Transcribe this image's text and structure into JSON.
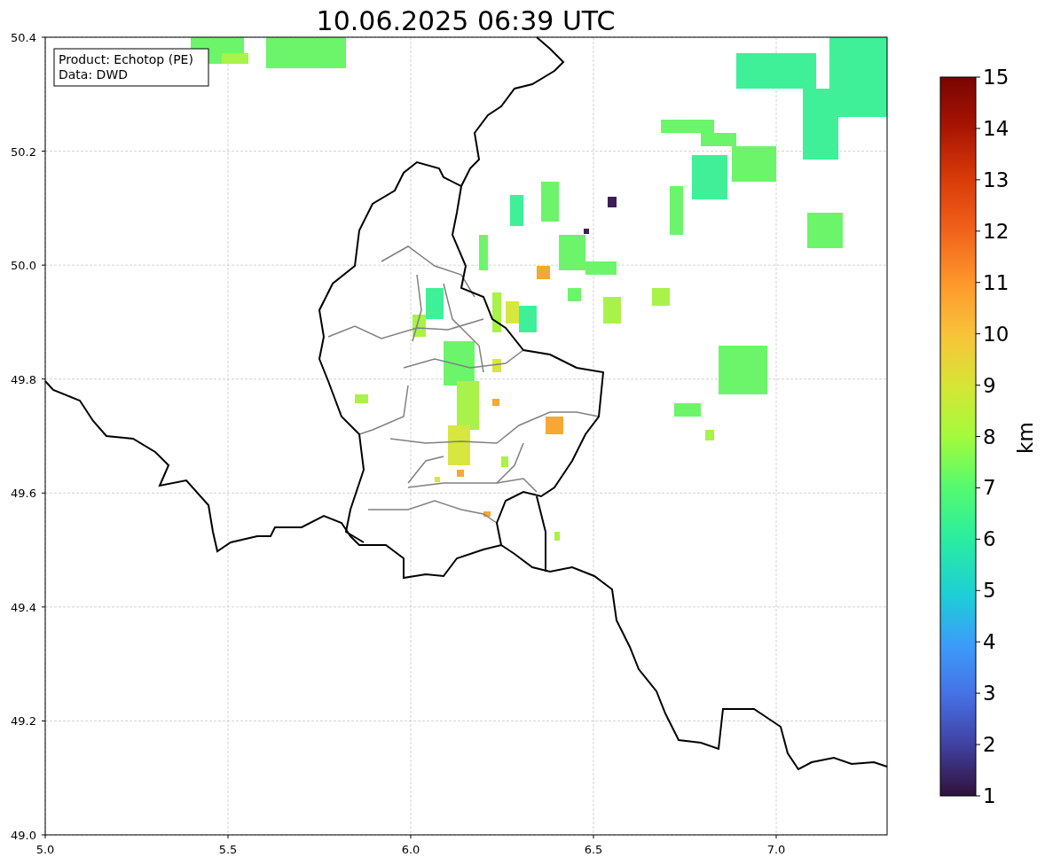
{
  "title": "10.06.2025 06:39 UTC",
  "legend": [
    "Product: Echotop (PE)",
    "Data: DWD"
  ],
  "x_ticks": [
    "5.0",
    "5.5",
    "6.0",
    "6.5",
    "7.0"
  ],
  "y_ticks": [
    "50.4",
    "50.2",
    "50.0",
    "49.8",
    "49.6",
    "49.4",
    "49.2",
    "49.0"
  ],
  "colorbar": {
    "label": "km",
    "ticks": [
      "15",
      "14",
      "13",
      "12",
      "11",
      "10",
      "9",
      "8",
      "7",
      "6",
      "5",
      "4",
      "3",
      "2",
      "1"
    ]
  }
}
